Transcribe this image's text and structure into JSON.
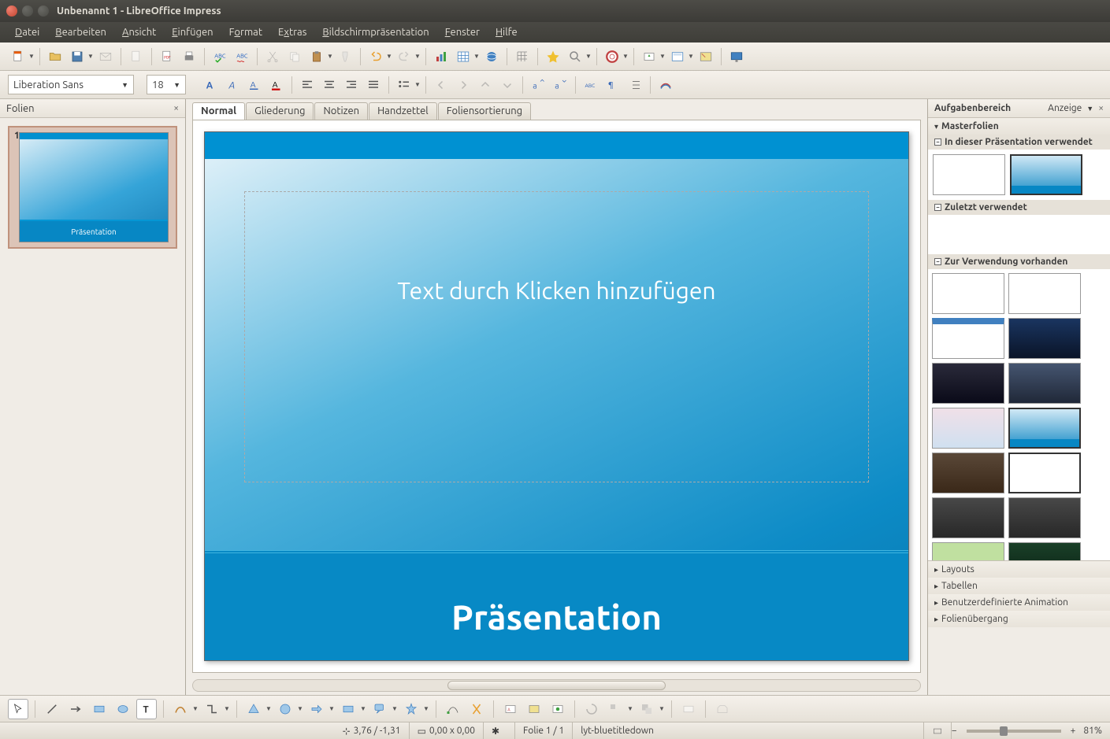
{
  "window": {
    "title": "Unbenannt 1 - LibreOffice Impress"
  },
  "menu": {
    "file": "Datei",
    "edit": "Bearbeiten",
    "view": "Ansicht",
    "insert": "Einfügen",
    "format": "Format",
    "extras": "Extras",
    "slideshow": "Bildschirmpräsentation",
    "window": "Fenster",
    "help": "Hilfe"
  },
  "font": {
    "name": "Liberation Sans",
    "size": "18"
  },
  "slides_panel": {
    "title": "Folien",
    "slide1_title": "Präsentation"
  },
  "view_tabs": {
    "normal": "Normal",
    "outline": "Gliederung",
    "notes": "Notizen",
    "handout": "Handzettel",
    "sorter": "Foliensortierung"
  },
  "slide": {
    "placeholder": "Text durch Klicken hinzufügen",
    "title": "Präsentation"
  },
  "task_pane": {
    "title": "Aufgabenbereich",
    "view_menu": "Anzeige",
    "masters": "Masterfolien",
    "used_in": "In dieser Präsentation verwendet",
    "recent": "Zuletzt verwendet",
    "available": "Zur Verwendung vorhanden",
    "layouts": "Layouts",
    "tables": "Tabellen",
    "custom_anim": "Benutzerdefinierte Animation",
    "transition": "Folienübergang"
  },
  "status": {
    "coords": "3,76 / -1,31",
    "size": "0,00 x 0,00",
    "slide_count": "Folie 1 / 1",
    "template": "lyt-bluetitledown",
    "zoom": "81%"
  }
}
